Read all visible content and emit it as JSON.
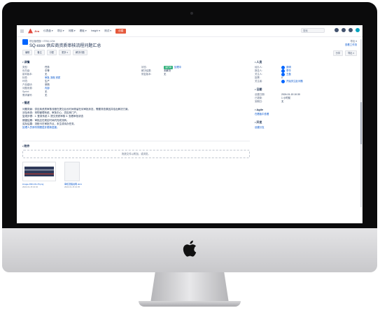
{
  "topnav": {
    "brand": "Jira",
    "items": [
      "仪表盘 ▾",
      "项目 ▾",
      "问题 ▾",
      "看板 ▾",
      "Insight ▾",
      "测试 ▾"
    ],
    "create_label": "创建",
    "search_placeholder": "搜索"
  },
  "header": {
    "breadcrumb": "项目管理部 / ITEM-1234",
    "title": "SQ-xxxx 供应商资质审核流程问题汇总",
    "toolbar": [
      "编辑",
      "备注",
      "分配",
      "更多 ▾",
      "解决问题"
    ],
    "right_label": "导出 ▾",
    "right_link": "查看工作流",
    "share": [
      "分享",
      "导出 ▾"
    ]
  },
  "details": {
    "title": "详情",
    "left": [
      {
        "label": "类型:",
        "value": "任务"
      },
      {
        "label": "优先级:",
        "value": "中等"
      },
      {
        "label": "影响版本:",
        "value": "无"
      },
      {
        "label": "标签:",
        "value": "审批 流程 资质"
      },
      {
        "label": "环境:",
        "value": "生产"
      },
      {
        "label": "产品模块:",
        "value": "采购"
      },
      {
        "label": "问题来源:",
        "value": "内部"
      },
      {
        "label": "Sprint:",
        "value": "无"
      },
      {
        "label": "需求编号:",
        "value": "无"
      }
    ],
    "right": [
      {
        "label": "状态:",
        "value": "处理中",
        "badge": "进行中"
      },
      {
        "label": "解决结果:",
        "value": "未解决"
      },
      {
        "label": "修复版本:",
        "value": "无"
      }
    ]
  },
  "description": {
    "title": "描述",
    "lines": [
      "问题背景：供应商资质审核流程在提交后长时间停留在待审批状态，需要排查原因并给出解决方案。",
      "涉及系统：采购管理系统、审批中心、供应商门户。",
      "复现步骤：1. 登录系统 2. 提交资质审核 3. 查看审批状态",
      "期望结果：审批应在规定时间内完成流转。",
      "实际结果：流程卡在审批节点，未生成待办任务。",
      "处理人员请尽快跟进并更新进度。"
    ]
  },
  "attachments": {
    "title": "附件",
    "drop_text": "拖放文件以附加，或浏览。",
    "files": [
      {
        "name": "image-2024-01-15.png",
        "meta": "2024-01-15 10:32"
      },
      {
        "name": "审核流程说明.docx",
        "meta": "2024-01-15 10:35"
      }
    ]
  },
  "people": {
    "title": "人员",
    "rows": [
      {
        "label": "经办人:",
        "value": "张明"
      },
      {
        "label": "报告人:",
        "value": "李华"
      },
      {
        "label": "关注人:",
        "value": "王磊"
      },
      {
        "label": "投票:",
        "value": "0"
      },
      {
        "label": "关注者:",
        "value": "开始关注此问题"
      }
    ]
  },
  "dates": {
    "title": "日期",
    "rows": [
      {
        "label": "创建日期:",
        "value": "2024-01-15 10:30"
      },
      {
        "label": "已更新:",
        "value": "1 小时前"
      },
      {
        "label": "到期日:",
        "value": "无"
      }
    ]
  },
  "agile": {
    "title": "Agile",
    "link": "在看板中查看"
  },
  "dev": {
    "title": "开发",
    "link": "创建分支"
  }
}
